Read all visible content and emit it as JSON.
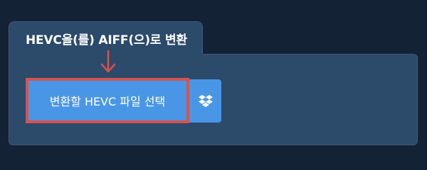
{
  "panel": {
    "title": "HEVC을(를) AIFF(으)로 변환"
  },
  "upload": {
    "select_label": "변환할 HEVC 파일 선택",
    "dropbox_icon": "dropbox-icon"
  },
  "colors": {
    "background": "#142236",
    "panel": "#2c4a6a",
    "button": "#4a96e6",
    "highlight": "#d6534f"
  }
}
